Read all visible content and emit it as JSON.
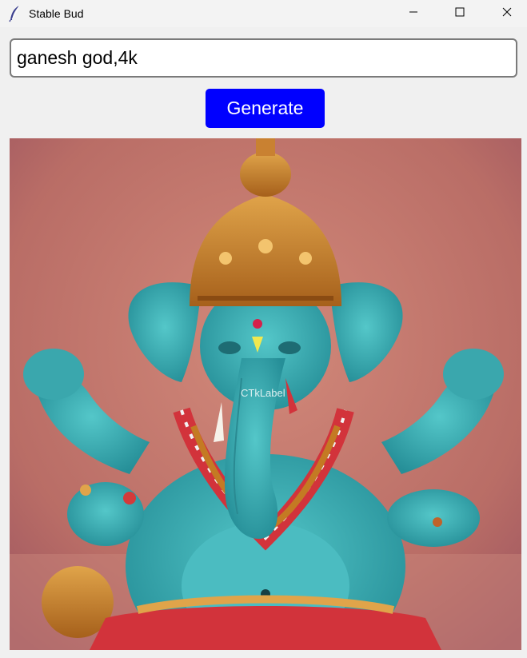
{
  "window": {
    "title": "Stable Bud"
  },
  "prompt": {
    "value": "ganesh god,4k"
  },
  "generate_button": {
    "label": "Generate"
  },
  "image": {
    "subject": "ganesh idol",
    "overlay_label": "CTkLabel"
  },
  "colors": {
    "button_bg": "#0000ff",
    "button_text": "#ffffff",
    "window_bg": "#f0f0f0"
  }
}
